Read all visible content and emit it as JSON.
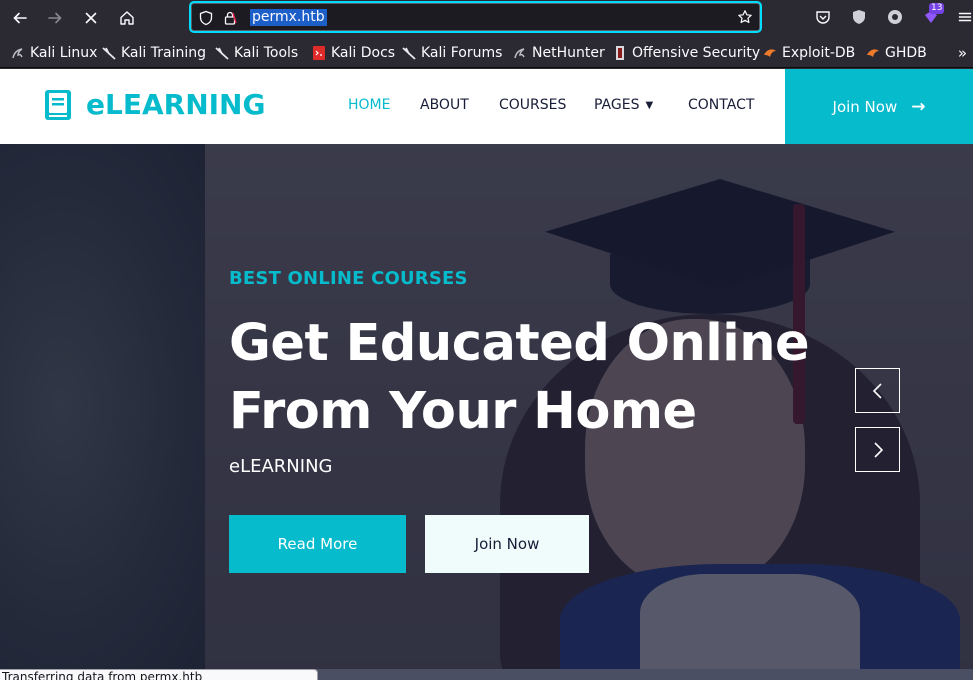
{
  "browser": {
    "url": "permx.htb",
    "status_text": "Transferring data from permx.htb",
    "extension_badge": "13",
    "bookmarks": [
      "Kali Linux",
      "Kali Training",
      "Kali Tools",
      "Kali Docs",
      "Kali Forums",
      "NetHunter",
      "Offensive Security",
      "Exploit-DB",
      "GHDB"
    ]
  },
  "site": {
    "brand": "eLEARNING",
    "nav": [
      "HOME",
      "ABOUT",
      "COURSES",
      "PAGES",
      "CONTACT"
    ],
    "join_label": "Join Now"
  },
  "hero": {
    "subtitle": "BEST ONLINE COURSES",
    "title_line1": "Get Educated Online",
    "title_line2": "From Your Home",
    "brand_text": "eLEARNING",
    "read_more_label": "Read More",
    "join_now_label": "Join Now"
  },
  "colors": {
    "accent": "#06bbcc",
    "dark": "#181d38",
    "browser_bg": "#2b2a33"
  }
}
